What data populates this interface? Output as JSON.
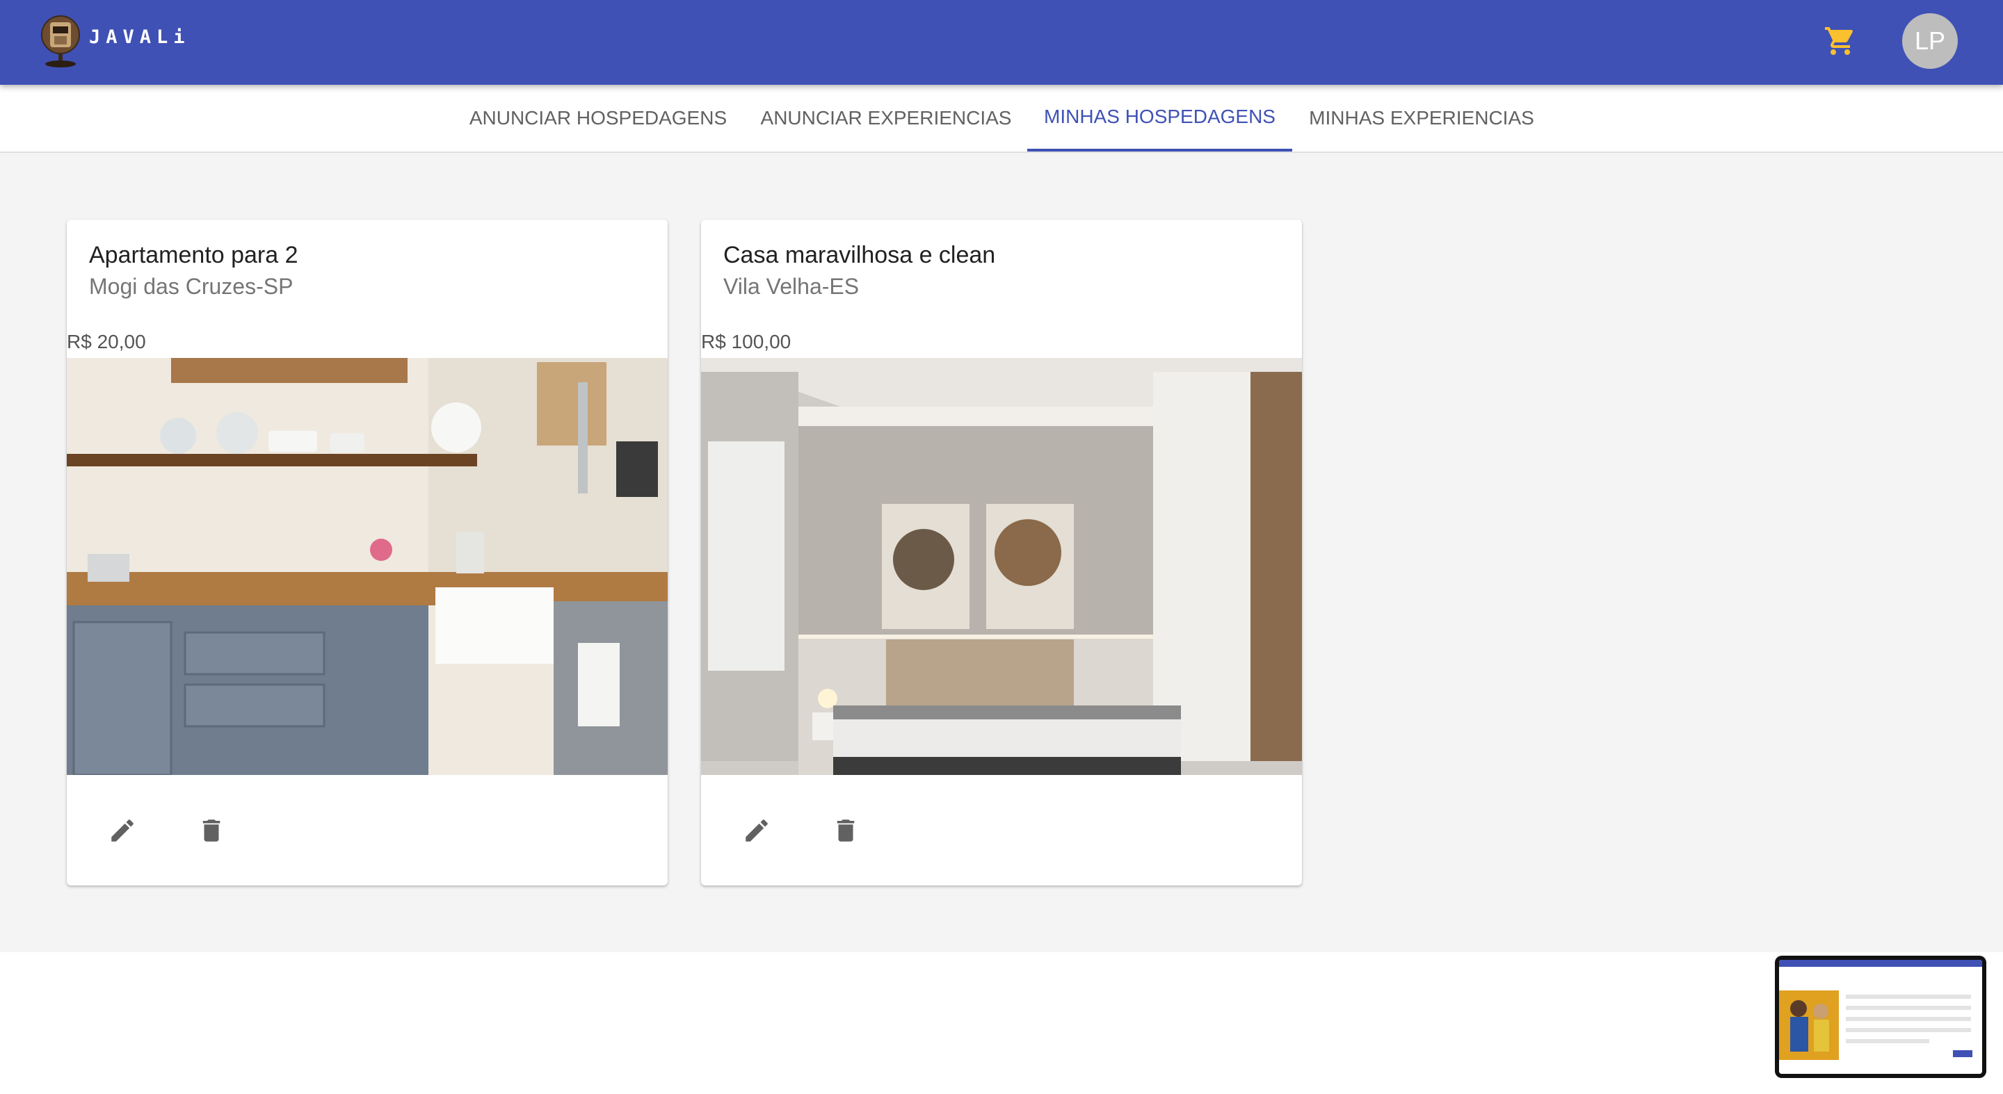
{
  "app": {
    "brand": "JAVALi"
  },
  "header": {
    "avatar_initials": "LP",
    "cart_icon": "shopping-cart-icon",
    "cart_color": "#fbc02d"
  },
  "tabs": [
    {
      "label": "ANUNCIAR HOSPEDAGENS",
      "active": false
    },
    {
      "label": "ANUNCIAR EXPERIENCIAS",
      "active": false
    },
    {
      "label": "MINHAS HOSPEDAGENS",
      "active": true
    },
    {
      "label": "MINHAS EXPERIENCIAS",
      "active": false
    }
  ],
  "listings": [
    {
      "title": "Apartamento para 2",
      "location": "Mogi das Cruzes-SP",
      "price": "R$ 20,00",
      "image": "kitchen-photo",
      "actions": [
        "edit-icon",
        "delete-icon"
      ]
    },
    {
      "title": "Casa maravilhosa e clean",
      "location": "Vila Velha-ES",
      "price": "R$ 100,00",
      "image": "bedroom-photo",
      "actions": [
        "edit-icon",
        "delete-icon"
      ]
    }
  ],
  "colors": {
    "primary": "#3f51b5",
    "background": "#f4f4f4",
    "icon": "#616161"
  }
}
